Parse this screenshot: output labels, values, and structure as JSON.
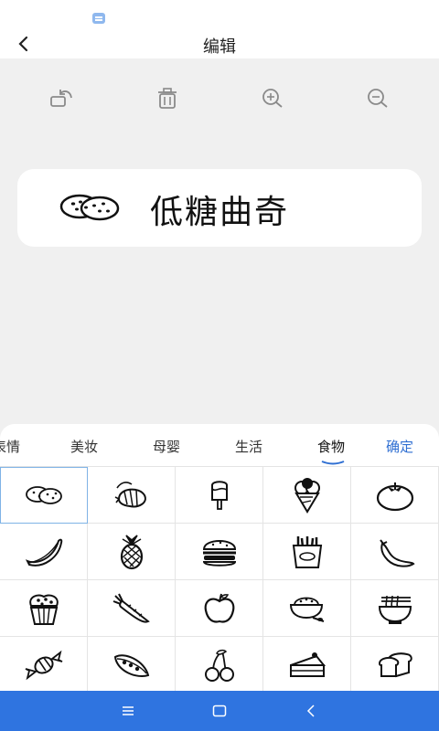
{
  "header": {
    "title": "编辑"
  },
  "toolbar": {
    "icons": [
      "rotate-icon",
      "trash-icon",
      "zoom-in-icon",
      "zoom-out-icon"
    ]
  },
  "preview": {
    "text": "低糖曲奇",
    "icon": "cookie-icon"
  },
  "tabs": [
    {
      "label": "表情",
      "active": false
    },
    {
      "label": "美妆",
      "active": false
    },
    {
      "label": "母婴",
      "active": false
    },
    {
      "label": "生活",
      "active": false
    },
    {
      "label": "食物",
      "active": true
    }
  ],
  "confirm_label": "确定",
  "stickers": [
    "cookie-icon",
    "shrimp-icon",
    "popsicle-icon",
    "ice-cream-icon",
    "tomato-icon",
    "banana-icon",
    "pineapple-icon",
    "burger-icon",
    "fries-icon",
    "chili-icon",
    "cupcake-icon",
    "carrot-icon",
    "apple-icon",
    "rice-bowl-icon",
    "noodle-bowl-icon",
    "candy-icon",
    "peapod-icon",
    "cherry-icon",
    "cake-slice-icon",
    "bread-icon"
  ],
  "selected_sticker": "cookie-icon",
  "colors": {
    "accent": "#2f6fd2",
    "navbar": "#2f74e0",
    "selected_border": "#7fb3e6"
  }
}
